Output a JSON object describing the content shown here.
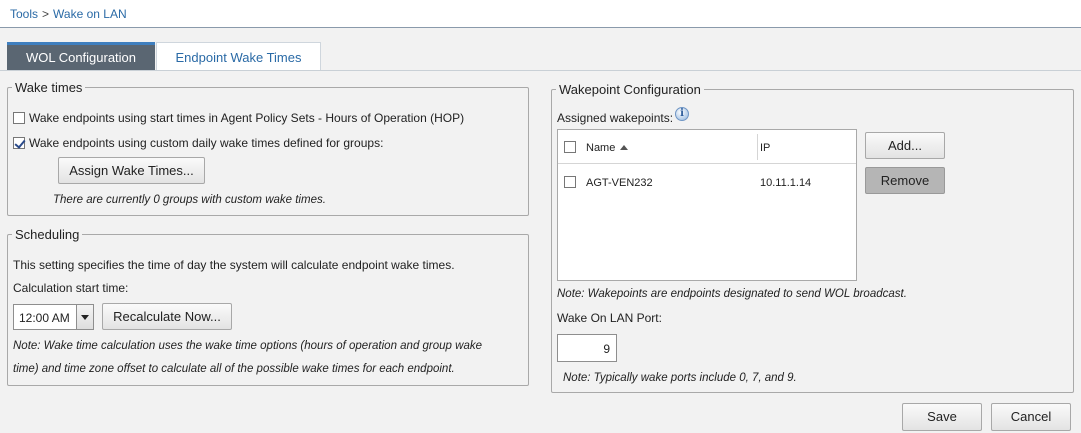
{
  "breadcrumb": {
    "parent": "Tools",
    "separator": ">",
    "current": "Wake on LAN"
  },
  "tabs": [
    {
      "label": "WOL Configuration",
      "active": true
    },
    {
      "label": "Endpoint Wake Times",
      "active": false
    }
  ],
  "wake_times": {
    "legend": "Wake times",
    "option_hop": {
      "label": "Wake endpoints using start times in Agent Policy Sets - Hours of Operation (HOP)",
      "checked": false
    },
    "option_custom": {
      "label": "Wake endpoints using custom daily wake times defined for groups:",
      "checked": true
    },
    "assign_button": "Assign Wake Times...",
    "groups_note": "There are currently 0 groups with custom wake times."
  },
  "scheduling": {
    "legend": "Scheduling",
    "description": "This setting specifies the time of day the system will calculate endpoint wake times.",
    "start_time_label": "Calculation start time:",
    "start_time_value": "12:00 AM",
    "recalculate_button": "Recalculate Now...",
    "note_line1": "Note: Wake time calculation uses the wake time options (hours of operation and group wake",
    "note_line2": "time) and time zone offset to calculate all of the possible wake times for each endpoint."
  },
  "wakepoint": {
    "legend": "Wakepoint Configuration",
    "assigned_label": "Assigned wakepoints:",
    "columns": {
      "name": "Name",
      "ip": "IP"
    },
    "rows": [
      {
        "name": "AGT-VEN232",
        "ip": "10.11.1.14",
        "checked": false
      }
    ],
    "add_button": "Add...",
    "remove_button": "Remove",
    "note": "Note: Wakepoints are endpoints designated to send WOL broadcast.",
    "port_label": "Wake On LAN Port:",
    "port_value": "9",
    "port_note": "Note: Typically wake ports include 0, 7, and 9."
  },
  "footer": {
    "save": "Save",
    "cancel": "Cancel"
  },
  "colors": {
    "link": "#2a6aa6",
    "active_tab": "#5a6672",
    "active_tab_accent": "#3f7fbf"
  }
}
